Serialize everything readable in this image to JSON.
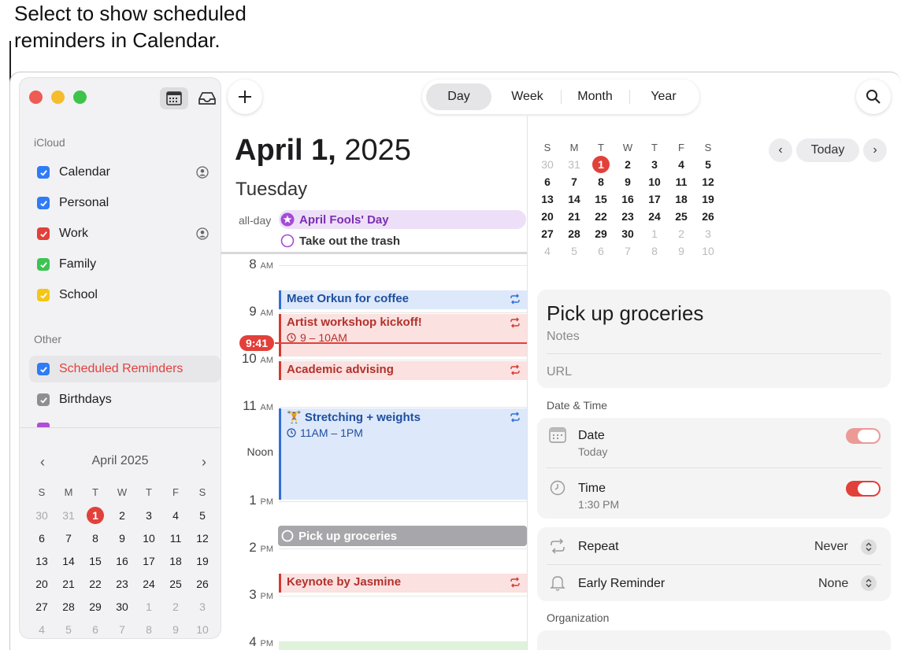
{
  "callout": {
    "line1": "Select to show scheduled",
    "line2": "reminders in Calendar."
  },
  "sidebar": {
    "icloud_label": "iCloud",
    "other_label": "Other",
    "calendars": [
      {
        "label": "Calendar",
        "color": "#2f7cf6",
        "shared": true
      },
      {
        "label": "Personal",
        "color": "#2f7cf6",
        "shared": false
      },
      {
        "label": "Work",
        "color": "#e2403a",
        "shared": true
      },
      {
        "label": "Family",
        "color": "#3cc452",
        "shared": false
      },
      {
        "label": "School",
        "color": "#f5c518",
        "shared": false
      }
    ],
    "other": [
      {
        "label": "Scheduled Reminders",
        "color": "#2f7cf6",
        "label_color": "#e2403a"
      },
      {
        "label": "Birthdays",
        "color": "#8e8e93"
      }
    ],
    "mini_cal": {
      "title": "April 2025",
      "weekdays": [
        "S",
        "M",
        "T",
        "W",
        "T",
        "F",
        "S"
      ],
      "days": [
        [
          "30",
          "31",
          "1",
          "2",
          "3",
          "4",
          "5"
        ],
        [
          "6",
          "7",
          "8",
          "9",
          "10",
          "11",
          "12"
        ],
        [
          "13",
          "14",
          "15",
          "16",
          "17",
          "18",
          "19"
        ],
        [
          "20",
          "21",
          "22",
          "23",
          "24",
          "25",
          "26"
        ],
        [
          "27",
          "28",
          "29",
          "30",
          "1",
          "2",
          "3"
        ],
        [
          "4",
          "5",
          "6",
          "7",
          "8",
          "9",
          "10"
        ]
      ]
    }
  },
  "toolbar": {
    "views": [
      "Day",
      "Week",
      "Month",
      "Year"
    ],
    "active_view": "Day"
  },
  "day_view": {
    "date_bold": "April 1,",
    "year": " 2025",
    "weekday": "Tuesday",
    "allday_label": "all-day",
    "allday_events": [
      "April Fools' Day",
      "Take out the trash"
    ],
    "hours": [
      {
        "h": "8",
        "p": "AM"
      },
      {
        "h": "9",
        "p": "AM"
      },
      {
        "h": "10",
        "p": "AM"
      },
      {
        "h": "11",
        "p": "AM"
      },
      {
        "h": "Noon",
        "p": ""
      },
      {
        "h": "1",
        "p": "PM"
      },
      {
        "h": "2",
        "p": "PM"
      },
      {
        "h": "3",
        "p": "PM"
      },
      {
        "h": "4",
        "p": "PM"
      }
    ],
    "now": "9:41",
    "events": {
      "coffee": "Meet Orkun for coffee",
      "workshop": "Artist workshop kickoff!",
      "workshop_time": "9 – 10AM",
      "advising": "Academic advising",
      "stretch": "Stretching + weights",
      "stretch_time": "11AM – 1PM",
      "groceries": "Pick up groceries",
      "keynote": "Keynote by Jasmine"
    },
    "colors": {
      "blue": "#2f6fd9",
      "red": "#d23a32",
      "red_bg": "#fbe1e0",
      "blue_bg": "#dde8fa",
      "purple_bg": "#eedff8"
    }
  },
  "right_cal": {
    "today_label": "Today",
    "weekdays": [
      "S",
      "M",
      "T",
      "W",
      "T",
      "F",
      "S"
    ],
    "days": [
      [
        "30",
        "31",
        "1",
        "2",
        "3",
        "4",
        "5"
      ],
      [
        "6",
        "7",
        "8",
        "9",
        "10",
        "11",
        "12"
      ],
      [
        "13",
        "14",
        "15",
        "16",
        "17",
        "18",
        "19"
      ],
      [
        "20",
        "21",
        "22",
        "23",
        "24",
        "25",
        "26"
      ],
      [
        "27",
        "28",
        "29",
        "30",
        "1",
        "2",
        "3"
      ],
      [
        "4",
        "5",
        "6",
        "7",
        "8",
        "9",
        "10"
      ]
    ]
  },
  "inspector": {
    "title": "Pick up groceries",
    "notes_placeholder": "Notes",
    "url_placeholder": "URL",
    "date_time_label": "Date & Time",
    "date_label": "Date",
    "date_value": "Today",
    "time_label": "Time",
    "time_value": "1:30 PM",
    "repeat_label": "Repeat",
    "repeat_value": "Never",
    "early_label": "Early Reminder",
    "early_value": "None",
    "org_label": "Organization"
  }
}
